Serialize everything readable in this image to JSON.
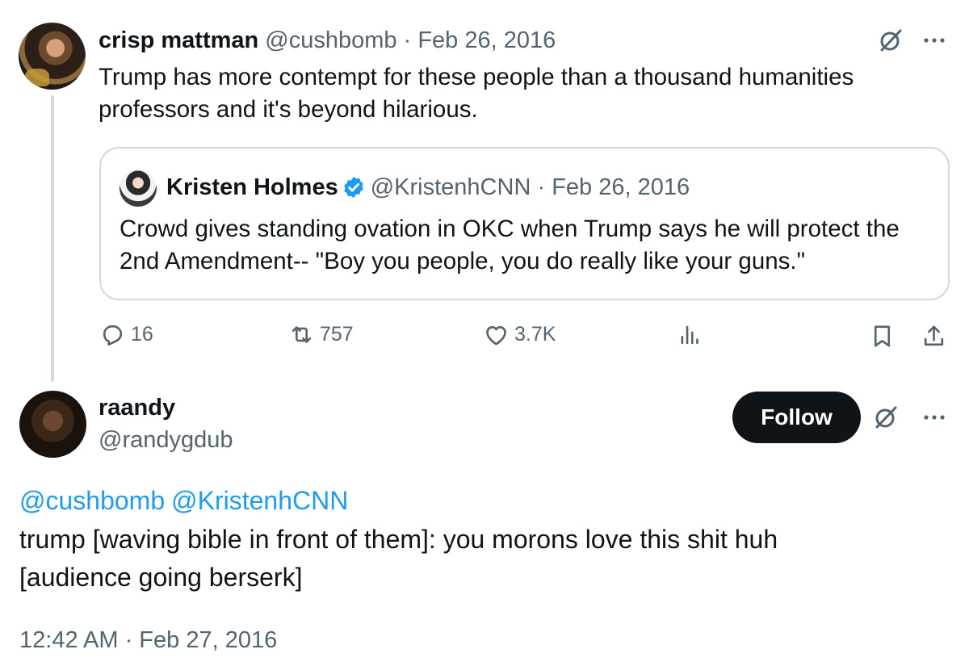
{
  "parent_tweet": {
    "author_name": "crisp mattman",
    "author_handle": "@cushbomb",
    "separator": "·",
    "date": "Feb 26, 2016",
    "text": "Trump has more contempt for these people than a thousand humanities professors and it's beyond hilarious.",
    "quote": {
      "author_name": "Kristen Holmes",
      "author_handle": "@KristenhCNN",
      "separator": "·",
      "date": "Feb 26, 2016",
      "verified": true,
      "text": "Crowd gives standing ovation in OKC when Trump says he will protect the 2nd Amendment-- \"Boy you people, you do really like your guns.\""
    },
    "actions": {
      "reply_count": "16",
      "retweet_count": "757",
      "like_count": "3.7K",
      "icons": [
        "reply-icon",
        "retweet-icon",
        "like-icon",
        "views-icon",
        "bookmark-icon",
        "share-icon"
      ]
    }
  },
  "reply_tweet": {
    "author_name": "raandy",
    "author_handle": "@randygdub",
    "follow_label": "Follow",
    "mentions": [
      "@cushbomb",
      "@KristenhCNN"
    ],
    "text_line1": "trump [waving bible in front of them]: you morons love this shit huh",
    "text_line2": "[audience going berserk]",
    "timestamp": "12:42 AM · Feb 27, 2016"
  },
  "colors": {
    "text": "#0f1419",
    "muted": "#536471",
    "link": "#1d9bf0",
    "border": "#cfd9de",
    "follow_bg": "#0f1419"
  }
}
